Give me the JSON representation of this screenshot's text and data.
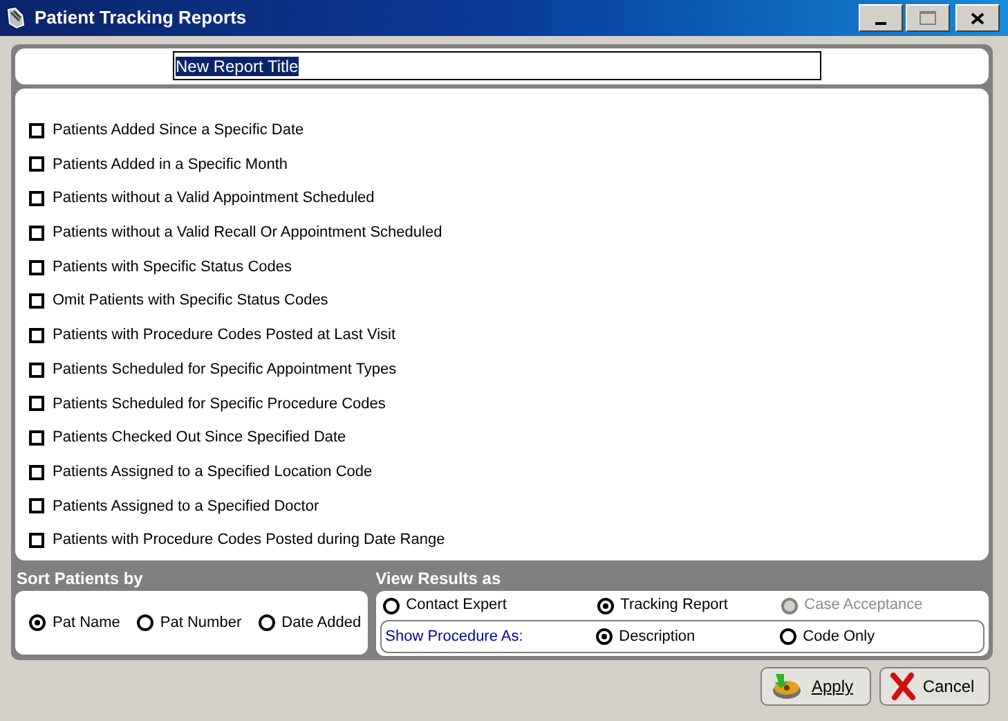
{
  "window": {
    "title": "Patient Tracking Reports"
  },
  "report_title": {
    "value": "New Report Title",
    "text_selected": true
  },
  "reports": [
    {
      "label": "Patients Added Since a Specific Date",
      "checked": false
    },
    {
      "label": "Patients Added in a Specific Month",
      "checked": false
    },
    {
      "label": "Patients without a Valid Appointment Scheduled",
      "checked": false
    },
    {
      "label": "Patients without a Valid Recall Or Appointment Scheduled",
      "checked": false
    },
    {
      "label": "Patients with Specific Status Codes",
      "checked": false
    },
    {
      "label": "Omit Patients with Specific Status Codes",
      "checked": false
    },
    {
      "label": "Patients with Procedure Codes Posted at Last Visit",
      "checked": false
    },
    {
      "label": "Patients Scheduled for Specific Appointment Types",
      "checked": false
    },
    {
      "label": "Patients Scheduled for Specific Procedure Codes",
      "checked": false
    },
    {
      "label": "Patients Checked Out Since Specified Date",
      "checked": false
    },
    {
      "label": "Patients Assigned to a Specified Location Code",
      "checked": false
    },
    {
      "label": "Patients Assigned to a Specified Doctor",
      "checked": false
    },
    {
      "label": "Patients with Procedure Codes Posted during Date Range",
      "checked": false
    }
  ],
  "sort": {
    "heading": "Sort Patients by",
    "options": [
      {
        "label": "Pat Name",
        "selected": true
      },
      {
        "label": "Pat Number",
        "selected": false
      },
      {
        "label": "Date Added",
        "selected": false
      }
    ]
  },
  "view": {
    "heading": "View Results as",
    "options": [
      {
        "label": "Contact Expert",
        "selected": false,
        "disabled": false
      },
      {
        "label": "Tracking Report",
        "selected": true,
        "disabled": false
      },
      {
        "label": "Case Acceptance",
        "selected": false,
        "disabled": true
      }
    ],
    "procedure": {
      "label": "Show Procedure As:",
      "options": [
        {
          "label": "Description",
          "selected": true
        },
        {
          "label": "Code Only",
          "selected": false
        }
      ]
    }
  },
  "buttons": [
    {
      "label": "Apply",
      "kind": "apply"
    },
    {
      "label": "Cancel",
      "kind": "cancel"
    }
  ]
}
